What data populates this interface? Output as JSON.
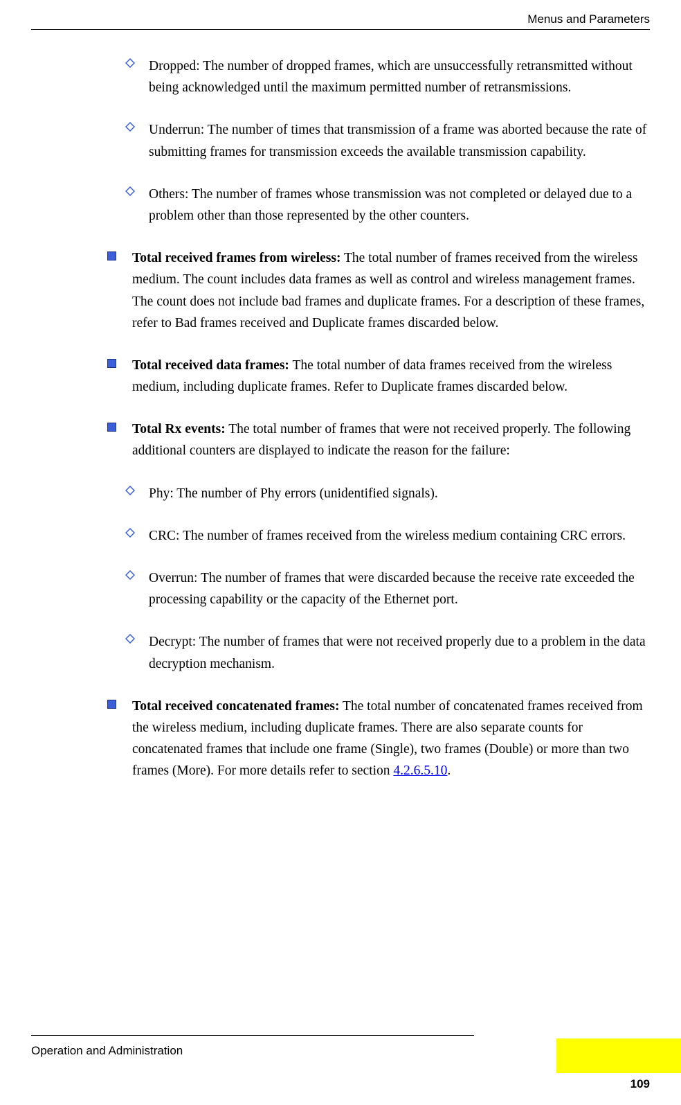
{
  "header": {
    "section_title": "Menus and Parameters"
  },
  "content": {
    "sub_items_a": [
      "Dropped:  The number of dropped frames, which are unsuccessfully retransmitted without being acknowledged until the maximum permitted number of retransmissions.",
      "Underrun: The number of times that transmission of a frame was aborted because the rate of submitting frames for transmission exceeds the available transmission capability.",
      "Others: The number of frames whose transmission was not completed or delayed due to a problem other than those represented by the other counters."
    ],
    "main_items": [
      {
        "label": "Total received frames from wireless:",
        "body": " The total number of frames received from the wireless medium. The count includes data frames as well as control and wireless management frames. The count does not include bad frames and duplicate frames. For a description of these frames, refer to Bad frames received and Duplicate frames discarded below."
      },
      {
        "label": "Total received data frames:",
        "body": " The total number of data frames received from the wireless medium, including duplicate frames. Refer to Duplicate frames discarded below."
      },
      {
        "label": "Total Rx events:",
        "body": " The total number of frames that were not received properly. The following additional counters are displayed to indicate the reason for the failure:"
      }
    ],
    "sub_items_b": [
      "Phy: The number of Phy errors (unidentified signals).",
      "CRC: The number of frames received from the wireless medium containing CRC errors.",
      "Overrun: The number of frames that were discarded because the receive rate exceeded the processing capability or the capacity of the Ethernet port.",
      "Decrypt: The number of frames that were not received properly due to a problem in the data decryption mechanism."
    ],
    "last_item": {
      "label": "Total received concatenated frames:",
      "body_pre": " The total number of concatenated frames received from the wireless medium, including duplicate frames. There are also separate counts for concatenated frames that include one frame (Single), two frames (Double) or more than two frames (More). For more details refer to section ",
      "link_text": "4.2.6.5.10",
      "body_post": "."
    }
  },
  "footer": {
    "left_text": "Operation and Administration",
    "page_number": "109"
  },
  "icons": {
    "square_fill": "#3b5fd9",
    "square_border": "#1a3090",
    "diamond_stroke": "#3b5fd9"
  }
}
